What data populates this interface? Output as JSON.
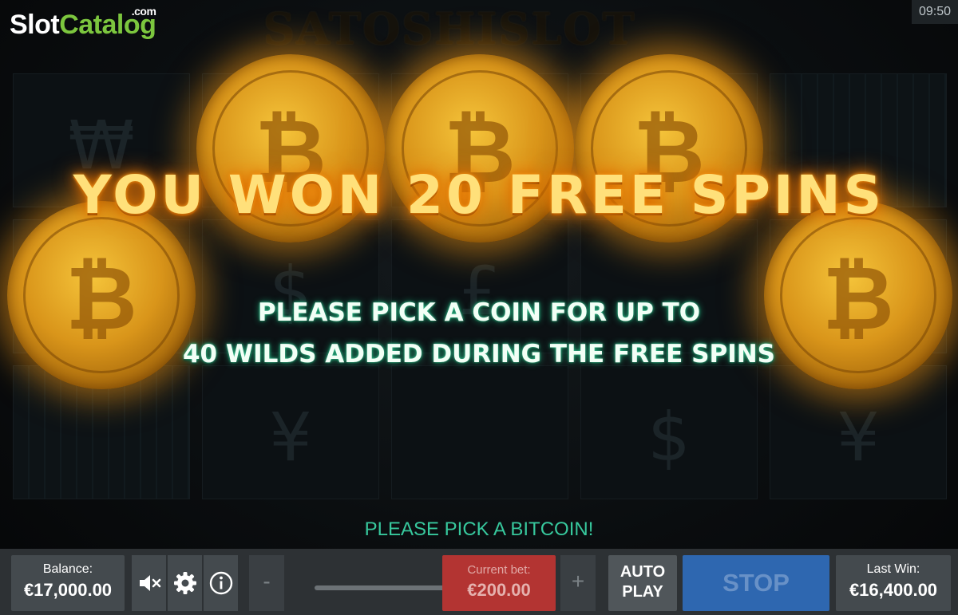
{
  "branding": {
    "logo_slot": "Slot",
    "logo_catalog": "Catalog",
    "logo_dotcom": ".com"
  },
  "clock": "09:50",
  "game": {
    "title": "SATOSHISLOT"
  },
  "overlay": {
    "headline": "YOU WON 20 FREE SPINS",
    "message_line1": "PLEASE PICK A COIN FOR UP TO",
    "message_line2": "40 WILDS ADDED DURING THE FREE SPINS",
    "coin_symbol": "₿"
  },
  "status": "PLEASE PICK A BITCOIN!",
  "controls": {
    "balance_label": "Balance:",
    "balance_value": "€17,000.00",
    "decrease_label": "-",
    "increase_label": "+",
    "bet_label": "Current bet:",
    "bet_value": "€200.00",
    "autoplay_line1": "AUTO",
    "autoplay_line2": "PLAY",
    "stop_label": "STOP",
    "last_win_label": "Last Win:",
    "last_win_value": "€16,400.00"
  },
  "icons": [
    "mute-icon",
    "settings-gear-icon",
    "info-icon",
    "bitcoin-icon"
  ],
  "colors": {
    "accent_green": "#37c89d",
    "bet_red": "#b33432",
    "stop_blue": "#2e67b0",
    "logo_green": "#7cc63e"
  }
}
